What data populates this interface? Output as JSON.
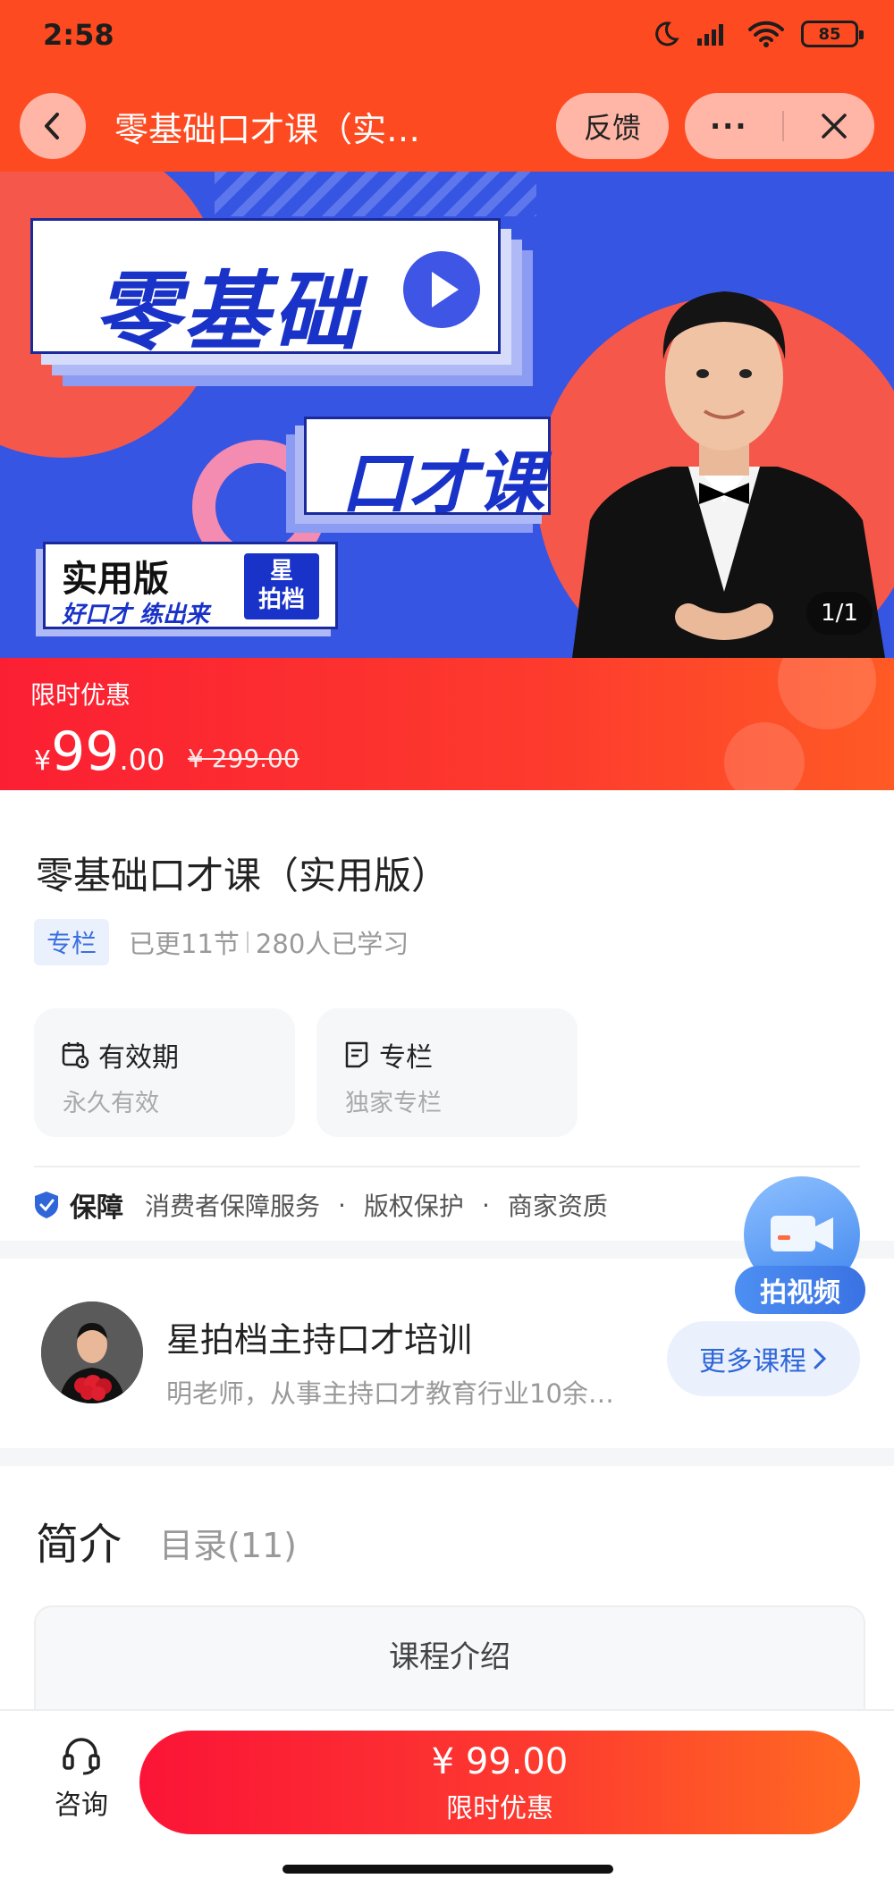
{
  "status_bar": {
    "time": "2:58",
    "battery": "85"
  },
  "nav": {
    "title": "零基础口才课（实…",
    "feedback": "反馈",
    "more": "···"
  },
  "banner": {
    "headline": "零基础",
    "subheadline": "口才课",
    "edition": "实用版",
    "slogan": "好口才 练出来",
    "brand_badge_line1": "星",
    "brand_badge_line2": "拍档",
    "pager": "1/1"
  },
  "price_bar": {
    "promo_label": "限时优惠",
    "currency": "¥",
    "price_int": "99",
    "price_dec": ".00",
    "original_price": "¥ 299.00"
  },
  "course": {
    "title": "零基础口才课（实用版）",
    "type_tag": "专栏",
    "updated": "已更11节",
    "learners": "280人已学习",
    "validity_title": "有效期",
    "validity_value": "永久有效",
    "column_title": "专栏",
    "column_value": "独家专栏"
  },
  "guarantee": {
    "label": "保障",
    "items": [
      "消费者保障服务",
      "版权保护",
      "商家资质"
    ]
  },
  "float_video": {
    "label": "拍视频"
  },
  "teacher": {
    "name": "星拍档主持口才培训",
    "desc": "明老师，从事主持口才教育行业10余…",
    "more_courses": "更多课程"
  },
  "tabs": {
    "intro": "简介",
    "catalog": "目录(11)"
  },
  "intro_box": {
    "heading": "课程介绍"
  },
  "bottom": {
    "consult": "咨询",
    "buy_price": "¥ 99.00",
    "buy_sub": "限时优惠"
  },
  "colors": {
    "brand_red": "#fe4a21",
    "banner_blue": "#3655e2",
    "accent_blue": "#3a6fe0"
  }
}
